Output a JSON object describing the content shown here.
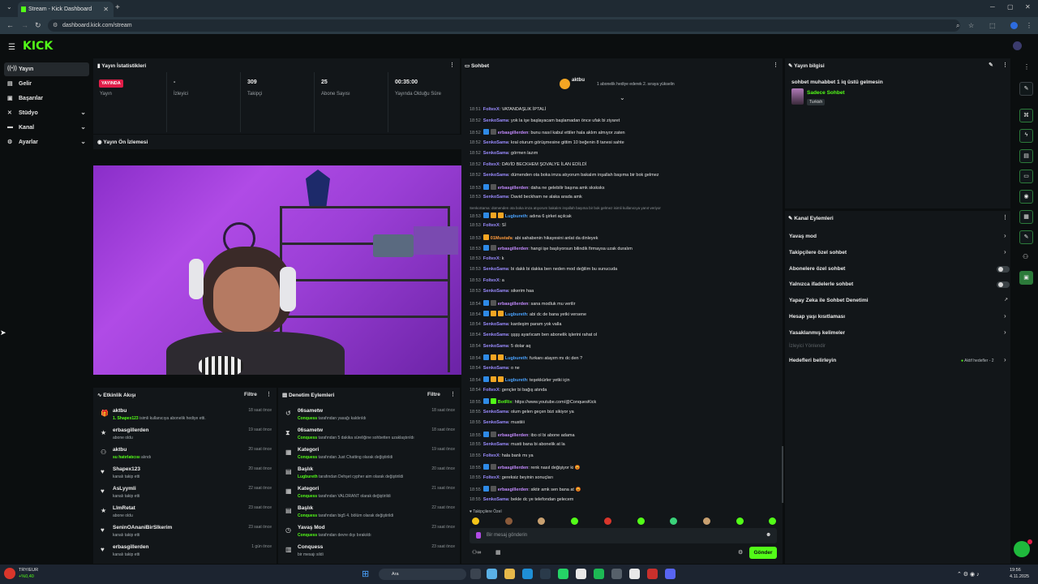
{
  "browser": {
    "tab_title": "Stream - Kick Dashboard",
    "url": "dashboard.kick.com/stream"
  },
  "app": {
    "logo": "KICK"
  },
  "sidebar": {
    "items": [
      {
        "label": "Yayın",
        "icon": "broadcast-icon",
        "active": true
      },
      {
        "label": "Gelir",
        "icon": "wallet-icon"
      },
      {
        "label": "Başarılar",
        "icon": "trophy-icon"
      },
      {
        "label": "Stüdyo",
        "icon": "studio-icon",
        "expandable": true
      },
      {
        "label": "Kanal",
        "icon": "channel-icon",
        "expandable": true
      },
      {
        "label": "Ayarlar",
        "icon": "gear-icon",
        "expandable": true
      }
    ]
  },
  "stats": {
    "title": "Yayın İstatistikleri",
    "live_badge": "YAYINDA",
    "items": [
      {
        "value": "",
        "label": "Yayın"
      },
      {
        "value": "-",
        "label": "İzleyici"
      },
      {
        "value": "309",
        "label": "Takipçi"
      },
      {
        "value": "25",
        "label": "Abone Sayısı"
      },
      {
        "value": "00:35:00",
        "label": "Yayında Olduğu Süre"
      }
    ]
  },
  "preview": {
    "title": "Yayın Ön İzlemesi"
  },
  "activity": {
    "title": "Etkinlik Akışı",
    "filter": "Filtre",
    "items": [
      {
        "name": "aktbu",
        "hl": "1. Shapex123",
        "text": " isimli kullanıcıya abonelik hediye etti.",
        "time": "18 saat önce",
        "icon": "gift-icon"
      },
      {
        "name": "erbasgillerden",
        "hl": "",
        "text": "abone oldu",
        "time": "19 saat önce",
        "icon": "star-icon"
      },
      {
        "name": "aktbu",
        "hl": "su hatırlatıcısı",
        "text": " alındı",
        "time": "20 saat önce",
        "icon": "redeem-icon"
      },
      {
        "name": "Shapex123",
        "hl": "",
        "text": "kanalı takip etti",
        "time": "20 saat önce",
        "icon": "heart-icon"
      },
      {
        "name": "AsLyymli",
        "hl": "",
        "text": "kanalı takip etti",
        "time": "22 saat önce",
        "icon": "heart-icon"
      },
      {
        "name": "LlmRetat",
        "hl": "",
        "text": "abone oldu",
        "time": "23 saat önce",
        "icon": "star-icon"
      },
      {
        "name": "SeninOAnaniBirSIkerim",
        "hl": "",
        "text": "kanalı takip etti",
        "time": "23 saat önce",
        "icon": "heart-icon"
      },
      {
        "name": "erbasgillerden",
        "hl": "",
        "text": "kanalı takip etti",
        "time": "1 gün önce",
        "icon": "heart-icon"
      }
    ]
  },
  "moderation": {
    "title": "Denetim Eylemleri",
    "filter": "Filtre",
    "items": [
      {
        "name": "06sametw",
        "hl": "Conquess",
        "text": " tarafından yasağı kaldırıldı",
        "time": "18 saat önce",
        "icon": "undo-icon"
      },
      {
        "name": "06sametw",
        "hl": "Conquess",
        "text": " tarafından 5 dakika süreliğine sohbetten uzaklaştırıldı",
        "time": "18 saat önce",
        "icon": "hourglass-icon"
      },
      {
        "name": "Kategori",
        "hl": "Conquess",
        "text": " tarafından Just Chatting olarak değiştirildi",
        "time": "19 saat önce",
        "icon": "category-icon"
      },
      {
        "name": "Başlık",
        "hl": "Lugbureth",
        "text": " tarafından Dehşet cypher aim olarak değiştirildi",
        "time": "20 saat önce",
        "icon": "title-icon"
      },
      {
        "name": "Kategori",
        "hl": "Conquess",
        "text": " tarafından VALORANT olarak değiştirildi",
        "time": "21 saat önce",
        "icon": "category-icon"
      },
      {
        "name": "Başlık",
        "hl": "Conquess",
        "text": " tarafından big5 4. bölüm olarak değiştirildi",
        "time": "22 saat önce",
        "icon": "title-icon"
      },
      {
        "name": "Yavaş Mod",
        "hl": "Conquess",
        "text": " tarafından devre dışı bırakıldı",
        "time": "23 saat önce",
        "icon": "slow-icon"
      },
      {
        "name": "Conquess",
        "hl": "",
        "text": "bir mesajı sildi",
        "time": "23 saat önce",
        "icon": "trash-icon"
      }
    ]
  },
  "chat": {
    "title": "Sohbet",
    "pinned_user": "aktbu",
    "pinned_text": "1 abonelik hediye ederek 2. sıraya yükselin",
    "messages": [
      {
        "t": "18:51",
        "u": "FoltexX",
        "c": "#9b8cff",
        "m": "VATANDAŞLIK İPTALİ",
        "b": []
      },
      {
        "t": "18:52",
        "u": "SenkoSama",
        "c": "#9b8cff",
        "m": "yok la işe başlayacam başlamadan önce ufak bi ziyaret",
        "b": []
      },
      {
        "t": "18:52",
        "u": "erbasgillerden",
        "c": "#c48bff",
        "m": "bunu nasıl kabul ettiler hala aklım almıyor zaten",
        "b": [
          "#2e8ae6",
          "#555"
        ]
      },
      {
        "t": "18:52",
        "u": "SenkoSama",
        "c": "#9b8cff",
        "m": "kral oturum görüşmesine gittim 10 beğenin 8 tanesi sahte",
        "b": []
      },
      {
        "t": "18:52",
        "u": "SenkoSama",
        "c": "#9b8cff",
        "m": "görmen lazım",
        "b": []
      },
      {
        "t": "18:52",
        "u": "FoltexX",
        "c": "#9b8cff",
        "m": "DAVİD BECKHEM ŞOVALYE İLAN EDİLDİ",
        "b": []
      },
      {
        "t": "18:52",
        "u": "SenkoSama",
        "c": "#9b8cff",
        "m": "dümenden ota boka imza atıyorum bakalım inşallah başıma bir bok gelmez",
        "b": []
      },
      {
        "t": "18:53",
        "u": "erbasgillerden",
        "c": "#c48bff",
        "m": "daha ne gelebilir başına amk sksksks",
        "b": [
          "#2e8ae6",
          "#555"
        ]
      },
      {
        "t": "18:53",
        "u": "SenkoSama",
        "c": "#9b8cff",
        "m": "David beckham ne alaka arada amk",
        "b": []
      },
      {
        "t": "18:53",
        "u": "Lugbureth",
        "c": "#4aa3ff",
        "m": "adına 6 şirket açılcak",
        "b": [
          "#2e8ae6",
          "#f5a623",
          "#f5a623"
        ]
      },
      {
        "t": "18:53",
        "u": "FoltexX",
        "c": "#9b8cff",
        "m": "Sİ",
        "b": []
      },
      {
        "t": "18:53",
        "u": "01Mustafa",
        "c": "#ff9b3d",
        "m": "abi sahabenin hikayesini anlat da dinleyek",
        "b": [
          "#f5a623"
        ]
      },
      {
        "t": "18:53",
        "u": "erbasgillerden",
        "c": "#c48bff",
        "m": "hangi işe başlıyorsun bilindik firmaysa uzak duralım",
        "b": [
          "#2e8ae6",
          "#555"
        ]
      },
      {
        "t": "18:53",
        "u": "FoltexX",
        "c": "#9b8cff",
        "m": "k",
        "b": []
      },
      {
        "t": "18:53",
        "u": "SenkoSama",
        "c": "#9b8cff",
        "m": "bi dakk bi dakka ben neden mod değilim bu sunucuda",
        "b": []
      },
      {
        "t": "18:53",
        "u": "FoltexX",
        "c": "#9b8cff",
        "m": "a",
        "b": []
      },
      {
        "t": "18:53",
        "u": "SenkoSama",
        "c": "#9b8cff",
        "m": "sikerim haa",
        "b": []
      },
      {
        "t": "18:54",
        "u": "erbasgillerden",
        "c": "#c48bff",
        "m": "sana modluk mu verilir",
        "b": [
          "#2e8ae6",
          "#555"
        ]
      },
      {
        "t": "18:54",
        "u": "Lugbureth",
        "c": "#4aa3ff",
        "m": "abi dc de bana yetki versene",
        "b": [
          "#2e8ae6",
          "#f5a623",
          "#f5a623"
        ]
      },
      {
        "t": "18:54",
        "u": "SenkoSama",
        "c": "#9b8cff",
        "m": "kardeşim param yok valla",
        "b": []
      },
      {
        "t": "18:54",
        "u": "SenkoSama",
        "c": "#9b8cff",
        "m": "şşşş ayarlıcam ben abonelik işlerini rahat ol",
        "b": []
      },
      {
        "t": "18:54",
        "u": "SenkoSama",
        "c": "#9b8cff",
        "m": "5 dolar aq",
        "b": []
      },
      {
        "t": "18:54",
        "u": "Lugbureth",
        "c": "#4aa3ff",
        "m": "furkanı atayım mı dc den ?",
        "b": [
          "#2e8ae6",
          "#f5a623",
          "#f5a623"
        ]
      },
      {
        "t": "18:54",
        "u": "SenkoSama",
        "c": "#9b8cff",
        "m": "o ne",
        "b": []
      },
      {
        "t": "18:54",
        "u": "Lugbureth",
        "c": "#4aa3ff",
        "m": "teşekkürler yetki için",
        "b": [
          "#2e8ae6",
          "#f5a623",
          "#f5a623"
        ]
      },
      {
        "t": "18:54",
        "u": "FoltexX",
        "c": "#9b8cff",
        "m": "gençler bi bağış atında",
        "b": []
      },
      {
        "t": "18:55",
        "u": "BotRix",
        "c": "#53fc18",
        "m": "https://www.youtube.com/@ConquesKick",
        "b": [
          "#2e8ae6",
          "#53fc18"
        ]
      },
      {
        "t": "18:55",
        "u": "SenkoSama",
        "c": "#9b8cff",
        "m": "olum gelen geçen bizi sikiyor ya",
        "b": []
      },
      {
        "t": "18:55",
        "u": "SenkoSama",
        "c": "#9b8cff",
        "m": "mustiiii",
        "b": []
      },
      {
        "t": "18:55",
        "u": "erbasgillerden",
        "c": "#c48bff",
        "m": "ibo ol bi abone adama",
        "b": [
          "#2e8ae6",
          "#555"
        ]
      },
      {
        "t": "18:55",
        "u": "SenkoSama",
        "c": "#9b8cff",
        "m": "musti bana bi abonelik at la",
        "b": []
      },
      {
        "t": "18:55",
        "u": "FoltexX",
        "c": "#9b8cff",
        "m": "hala banlı mı ya",
        "b": []
      },
      {
        "t": "18:55",
        "u": "erbasgillerden",
        "c": "#c48bff",
        "m": "renk nasıl değişiyor ki 😡",
        "b": [
          "#2e8ae6",
          "#555"
        ]
      },
      {
        "t": "18:55",
        "u": "FoltexX",
        "c": "#9b8cff",
        "m": "gereksiz beyinin sonuçları",
        "b": []
      },
      {
        "t": "18:55",
        "u": "erbasgillerden",
        "c": "#c48bff",
        "m": "siktir amk sen bana at 😡",
        "b": [
          "#2e8ae6",
          "#555"
        ]
      },
      {
        "t": "18:55",
        "u": "SenkoSama",
        "c": "#9b8cff",
        "m": "bekle dc ye telefondan gelecem",
        "b": []
      }
    ],
    "reply_hint": "SenkoSama: dümenden ota boka imza atıyorum bakalım inşallah başıma bir bok gelmez isimli kullanıcıya yanıt veriyor",
    "followers_only_label": "Takipçilere Özel",
    "input_placeholder": "Bir mesaj gönderin",
    "send_label": "Gönder"
  },
  "stream_info": {
    "title": "Yayın bilgisi",
    "stream_title": "sohbet muhabbet 1 iq üstü gelmesin",
    "category": "Sadece Sohbet",
    "tag": "Turkish"
  },
  "channel_actions": {
    "title": "Kanal Eylemleri",
    "items": [
      {
        "label": "Yavaş mod",
        "type": "chevron"
      },
      {
        "label": "Takipçilere özel sohbet",
        "type": "chevron"
      },
      {
        "label": "Abonelere özel sohbet",
        "type": "toggle"
      },
      {
        "label": "Yalnızca ifadelerle sohbet",
        "type": "toggle"
      },
      {
        "label": "Yapay Zeka ile Sohbet Denetimi",
        "type": "external"
      },
      {
        "label": "Hesap yaşı kısıtlaması",
        "type": "chevron"
      },
      {
        "label": "Yasaklanmış kelimeler",
        "type": "chevron"
      }
    ],
    "disabled_item": "İzleyici Yönlendir",
    "goals_label": "Hedefleri belirleyin",
    "goals_status": "Aktif hedefler - 2"
  },
  "taskbar": {
    "currency": "TRY/EUR",
    "currency_change": "+%0,40",
    "search": "Ara",
    "time": "19:56",
    "date": "4.11.2025"
  },
  "colors": {
    "accent": "#53fc18",
    "live": "#e11d48",
    "bg": "#0b0e0f",
    "panel": "#121619"
  }
}
